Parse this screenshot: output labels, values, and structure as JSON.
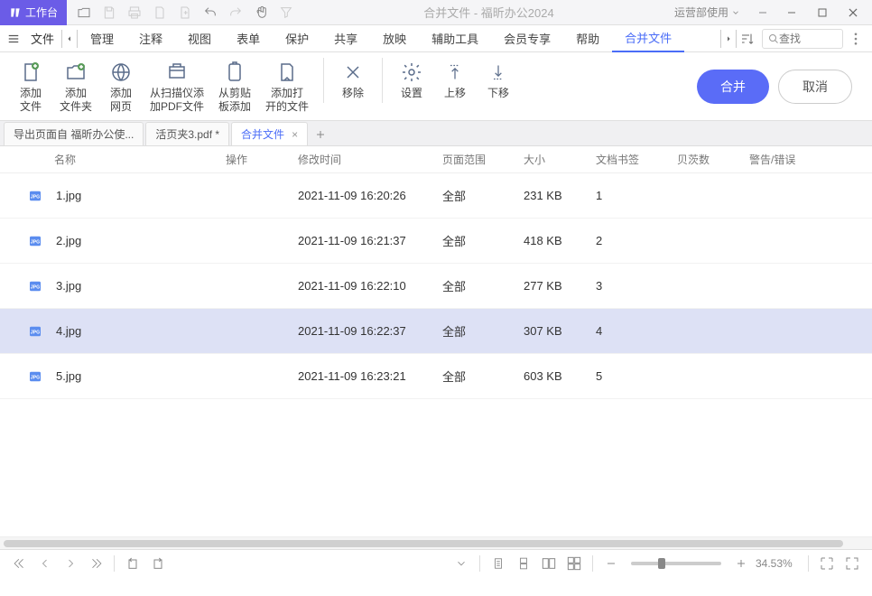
{
  "titlebar": {
    "workspace": "工作台",
    "title": "合并文件 - 福昕办公2024",
    "usage": "运营部使用"
  },
  "menubar": {
    "file": "文件",
    "items": [
      "管理",
      "注释",
      "视图",
      "表单",
      "保护",
      "共享",
      "放映",
      "辅助工具",
      "会员专享",
      "帮助",
      "合并文件"
    ],
    "active_index": 10,
    "search_placeholder": "查找"
  },
  "ribbon": {
    "buttons": [
      {
        "label": "添加\n文件"
      },
      {
        "label": "添加\n文件夹"
      },
      {
        "label": "添加\n网页"
      },
      {
        "label": "从扫描仪添\n加PDF文件"
      },
      {
        "label": "从剪贴\n板添加"
      },
      {
        "label": "添加打\n开的文件"
      },
      {
        "label": "移除"
      },
      {
        "label": "设置"
      },
      {
        "label": "上移"
      },
      {
        "label": "下移"
      }
    ],
    "merge": "合并",
    "cancel": "取消"
  },
  "tabs": [
    {
      "label": "导出页面自 福昕办公使..."
    },
    {
      "label": "活页夹3.pdf *"
    },
    {
      "label": "合并文件",
      "active": true,
      "closeable": true
    }
  ],
  "table": {
    "headers": {
      "name": "名称",
      "op": "操作",
      "time": "修改时间",
      "range": "页面范围",
      "size": "大小",
      "bookmark": "文档书签",
      "bates": "贝茨数",
      "warn": "警告/错误"
    },
    "rows": [
      {
        "name": "1.jpg",
        "time": "2021-11-09 16:20:26",
        "range": "全部",
        "size": "231 KB",
        "bookmark": "1"
      },
      {
        "name": "2.jpg",
        "time": "2021-11-09 16:21:37",
        "range": "全部",
        "size": "418 KB",
        "bookmark": "2"
      },
      {
        "name": "3.jpg",
        "time": "2021-11-09 16:22:10",
        "range": "全部",
        "size": "277 KB",
        "bookmark": "3"
      },
      {
        "name": "4.jpg",
        "time": "2021-11-09 16:22:37",
        "range": "全部",
        "size": "307 KB",
        "bookmark": "4",
        "selected": true
      },
      {
        "name": "5.jpg",
        "time": "2021-11-09 16:23:21",
        "range": "全部",
        "size": "603 KB",
        "bookmark": "5"
      }
    ]
  },
  "statusbar": {
    "zoom": "34.53%"
  }
}
